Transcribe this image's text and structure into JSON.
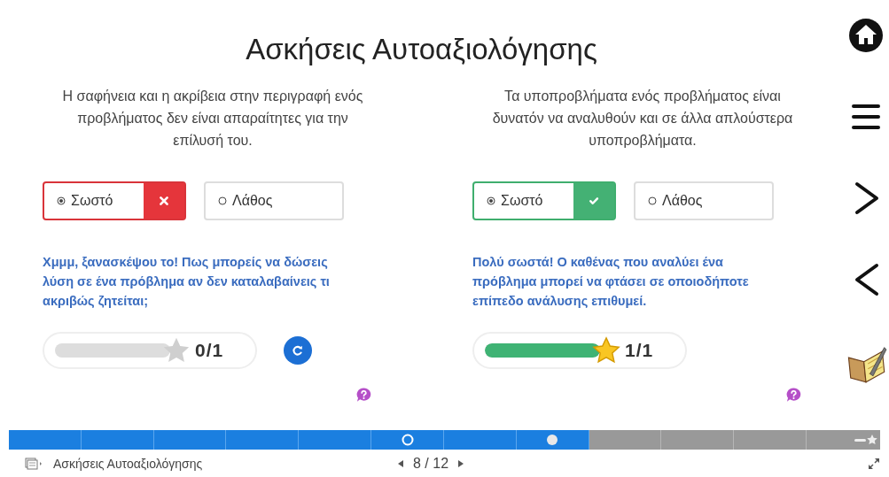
{
  "title": "Ασκήσεις Αυτοαξιολόγησης",
  "questions": [
    {
      "text": "Η σαφήνεια και η ακρίβεια στην περιγραφή ενός προβλήματος δεν είναι απαραίτητες για την επίλυσή του.",
      "options": [
        {
          "label": "Σωστό",
          "selected": true
        },
        {
          "label": "Λάθος",
          "selected": false
        }
      ],
      "kind": "wrong",
      "feedback": "Χμμμ, ξανασκέψου το! Πως μπορείς να δώσεις λύση σε ένα πρόβλημα αν δεν καταλαβαίνεις τι ακριβώς ζητείται;",
      "level": 0,
      "star_earned": false,
      "score": "0/1",
      "retry": true
    },
    {
      "text": "Τα υποπροβλήματα ενός προβλήματος είναι δυνατόν να αναλυθούν και σε άλλα απλούστερα υποπροβλήματα.",
      "options": [
        {
          "label": "Σωστό",
          "selected": true
        },
        {
          "label": "Λάθος",
          "selected": false
        }
      ],
      "kind": "correct",
      "feedback": "Πολύ σωστά! Ο καθένας που αναλύει ένα πρόβλημα μπορεί να φτάσει σε οποιοδήποτε επίπεδο ανάλυσης επιθυμεί.",
      "level": 1,
      "star_earned": true,
      "score": "1/1",
      "retry": false
    }
  ],
  "progress_bar": {
    "segments": [
      {
        "done": true,
        "kind": "plain"
      },
      {
        "done": true,
        "kind": "plain"
      },
      {
        "done": true,
        "kind": "plain"
      },
      {
        "done": true,
        "kind": "plain"
      },
      {
        "done": true,
        "kind": "plain"
      },
      {
        "done": true,
        "kind": "open"
      },
      {
        "done": true,
        "kind": "plain"
      },
      {
        "done": true,
        "kind": "filled"
      },
      {
        "done": false,
        "kind": "plain"
      },
      {
        "done": false,
        "kind": "plain"
      },
      {
        "done": false,
        "kind": "plain"
      },
      {
        "done": false,
        "kind": "star"
      }
    ]
  },
  "footer": {
    "title": "Ασκήσεις Αυτοαξιολόγησης",
    "page": "8 / 12"
  }
}
